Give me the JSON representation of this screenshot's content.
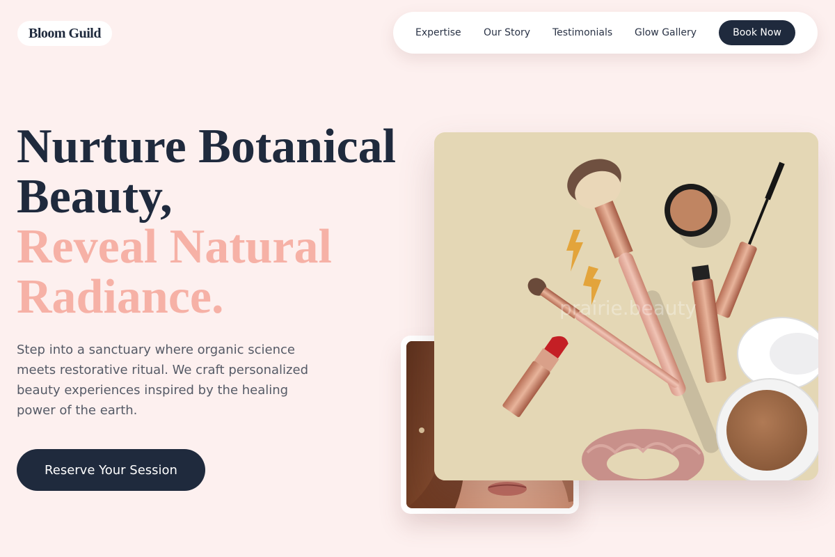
{
  "brand": {
    "name": "Bloom Guild"
  },
  "nav": {
    "links": [
      "Expertise",
      "Our Story",
      "Testimonials",
      "Glow Gallery"
    ],
    "cta": "Book Now"
  },
  "hero": {
    "headline_dark_1": "Nurture Botanical",
    "headline_dark_2": "Beauty,",
    "headline_pink_1": "Reveal Natural",
    "headline_pink_2": "Radiance.",
    "description": "Step into a sanctuary where organic science meets restorative ritual. We craft personalized beauty experiences inspired by the healing power of the earth.",
    "cta": "Reserve Your Session"
  },
  "images": {
    "main_watermark": "prairie.beauty"
  },
  "colors": {
    "background": "#fdf0ef",
    "navy": "#1f2a3d",
    "accent_pink": "#f6b1a6",
    "image_bg": "#e4d7b5"
  }
}
